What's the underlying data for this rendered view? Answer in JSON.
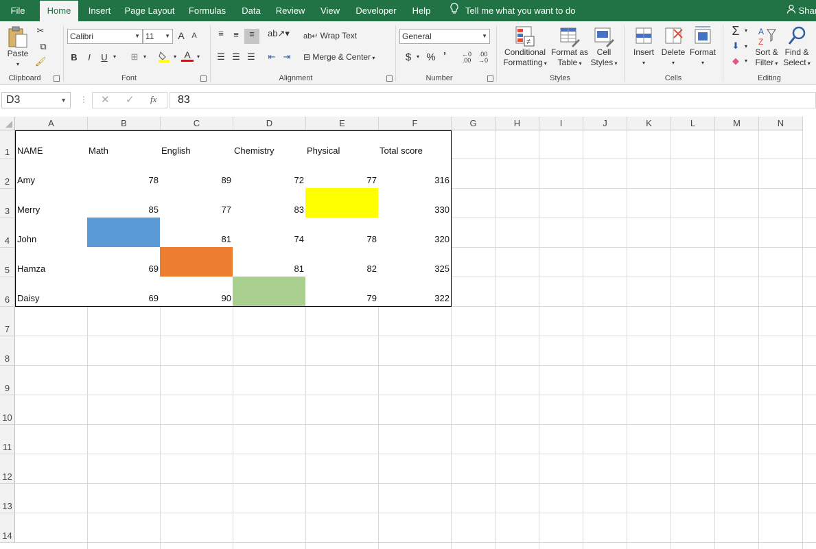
{
  "menu": {
    "tabs": [
      "File",
      "Home",
      "Insert",
      "Page Layout",
      "Formulas",
      "Data",
      "Review",
      "View",
      "Developer",
      "Help"
    ],
    "active_tab": "Home",
    "tell_me": "Tell me what you want to do",
    "share": "Share"
  },
  "ribbon": {
    "clipboard": {
      "paste": "Paste",
      "label": "Clipboard"
    },
    "font": {
      "name": "Calibri",
      "size": "11",
      "bold": "B",
      "italic": "I",
      "underline": "U",
      "grow": "A",
      "shrink": "A",
      "font_color": "A",
      "label": "Font"
    },
    "alignment": {
      "wrap_text": "Wrap Text",
      "merge_center": "Merge & Center",
      "label": "Alignment"
    },
    "number": {
      "format": "General",
      "currency": "$",
      "percent": "%",
      "comma": "’",
      "label": "Number"
    },
    "styles": {
      "conditional_1": "Conditional",
      "conditional_2": "Formatting",
      "table_1": "Format as",
      "table_2": "Table",
      "cell_1": "Cell",
      "cell_2": "Styles",
      "label": "Styles"
    },
    "cells": {
      "insert": "Insert",
      "delete": "Delete",
      "format": "Format",
      "label": "Cells"
    },
    "editing": {
      "sort_1": "Sort &",
      "sort_2": "Filter",
      "find_1": "Find &",
      "find_2": "Select",
      "label": "Editing"
    }
  },
  "formula_bar": {
    "name_box": "D3",
    "cancel": "✕",
    "enter": "✓",
    "fx": "fx",
    "value": "83"
  },
  "sheet": {
    "columns": [
      "A",
      "B",
      "C",
      "D",
      "E",
      "F",
      "G",
      "H",
      "I",
      "J",
      "K",
      "L",
      "M",
      "N"
    ],
    "rows": [
      "1",
      "2",
      "3",
      "4",
      "5",
      "6",
      "7",
      "8",
      "9",
      "10",
      "11",
      "12",
      "13",
      "14"
    ],
    "header": [
      "NAME",
      "Math",
      "English",
      "Chemistry",
      "Physical",
      "Total score"
    ],
    "data": [
      [
        "Amy",
        "78",
        "89",
        "72",
        "77",
        "316"
      ],
      [
        "Merry",
        "85",
        "77",
        "83",
        "",
        "330"
      ],
      [
        "John",
        "",
        "81",
        "74",
        "78",
        "320"
      ],
      [
        "Hamza",
        "69",
        "",
        "81",
        "82",
        "325"
      ],
      [
        "Daisy",
        "69",
        "90",
        "",
        "79",
        "322"
      ]
    ],
    "fills": {
      "E3": "#ffff00",
      "B4": "#5b9bd5",
      "C5": "#ed7d31",
      "D6": "#a9d08e"
    }
  }
}
